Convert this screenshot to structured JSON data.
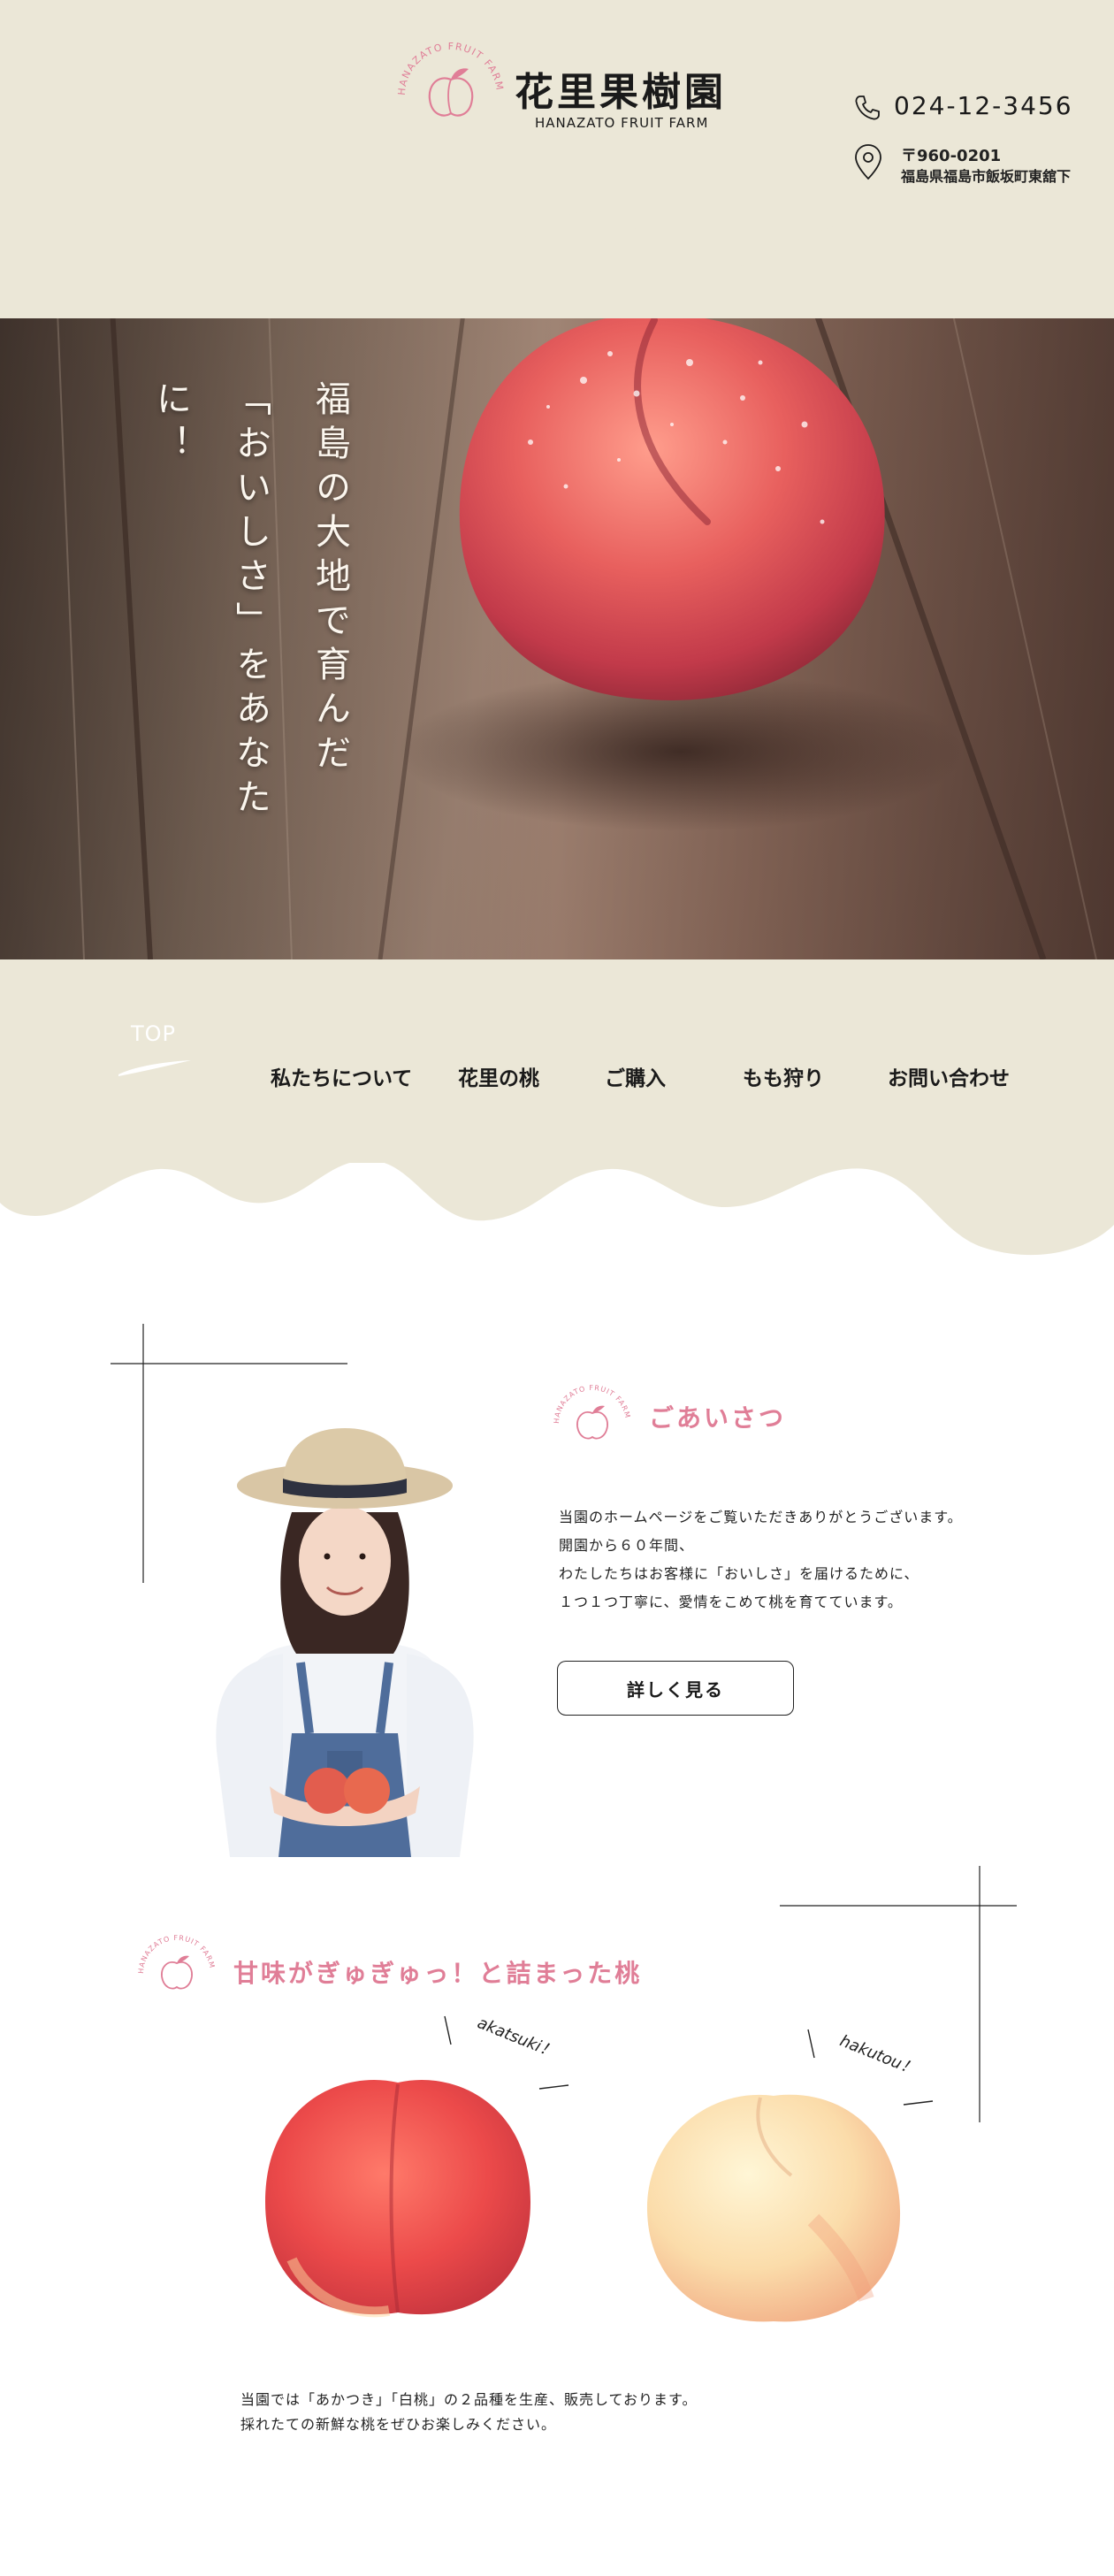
{
  "brand": {
    "name_jp": "花里果樹園",
    "name_en": "HANAZATO FRUIT FARM",
    "emblem_ring_text": "HANAZATO FRUIT FARM"
  },
  "contact": {
    "phone": "024-12-3456",
    "postal_code": "〒960-0201",
    "address": "福島県福島市飯坂町東舘下",
    "phone_icon": "phone-icon",
    "pin_icon": "map-pin-icon"
  },
  "hero": {
    "copy_line1": "福島の大地で育んだ",
    "copy_line2": "「おいしさ」をあなたに！"
  },
  "nav": {
    "top": "TOP",
    "items": [
      "私たちについて",
      "花里の桃",
      "ご購入",
      "もも狩り",
      "お問い合わせ"
    ]
  },
  "greeting": {
    "heading": "ごあいさつ",
    "lines": [
      "当園のホームページをご覧いただきありがとうございます。",
      "開園から６０年間、",
      "わたしたちはお客様に「おいしさ」を届けるために、",
      "１つ１つ丁寧に、愛情をこめて桃を育てています。"
    ],
    "button": "詳しく見る"
  },
  "peaches": {
    "heading": "甘味がぎゅぎゅっ！と詰まった桃",
    "tag1": "akatsuki！",
    "tag2": "hakutou！",
    "lines": [
      "当園では「あかつき」「白桃」の２品種を生産、販売しております。",
      "採れたての新鮮な桃をぜひお楽しみください。"
    ]
  },
  "colors": {
    "cream": "#ebe7d7",
    "accent_pink": "#e07e97",
    "text": "#1a1a1a"
  }
}
